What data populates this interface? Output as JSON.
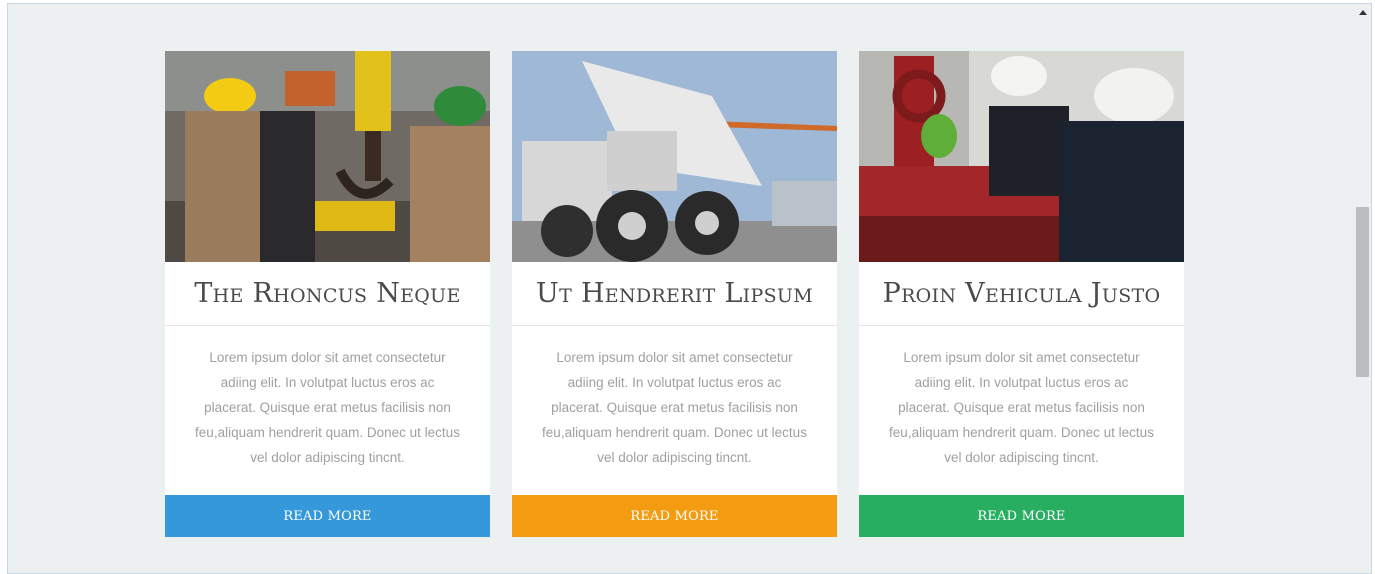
{
  "cards": [
    {
      "title": "The Rhoncus Neque",
      "text": "Lorem ipsum dolor sit amet consectetur adiing elit. In volutpat luctus eros ac placerat. Quisque erat metus facilisis non feu,aliquam hendrerit quam. Donec ut lectus vel dolor adipiscing tincnt.",
      "button": "READ MORE",
      "button_color": "#3498db",
      "image": "workers-with-crane-hook"
    },
    {
      "title": "Ut Hendrerit Lipsum",
      "text": "Lorem ipsum dolor sit amet consectetur adiing elit. In volutpat luctus eros ac placerat. Quisque erat metus facilisis non feu,aliquam hendrerit quam. Donec ut lectus vel dolor adipiscing tincnt.",
      "button": "READ MORE",
      "button_color": "#f39c12",
      "image": "mining-dump-truck"
    },
    {
      "title": "Proin Vehicula Justo",
      "text": "Lorem ipsum dolor sit amet consectetur adiing elit. In volutpat luctus eros ac placerat. Quisque erat metus facilisis non feu,aliquam hendrerit quam. Donec ut lectus vel dolor adipiscing tincnt.",
      "button": "READ MORE",
      "button_color": "#27ae60",
      "image": "oil-rig-workers"
    }
  ]
}
